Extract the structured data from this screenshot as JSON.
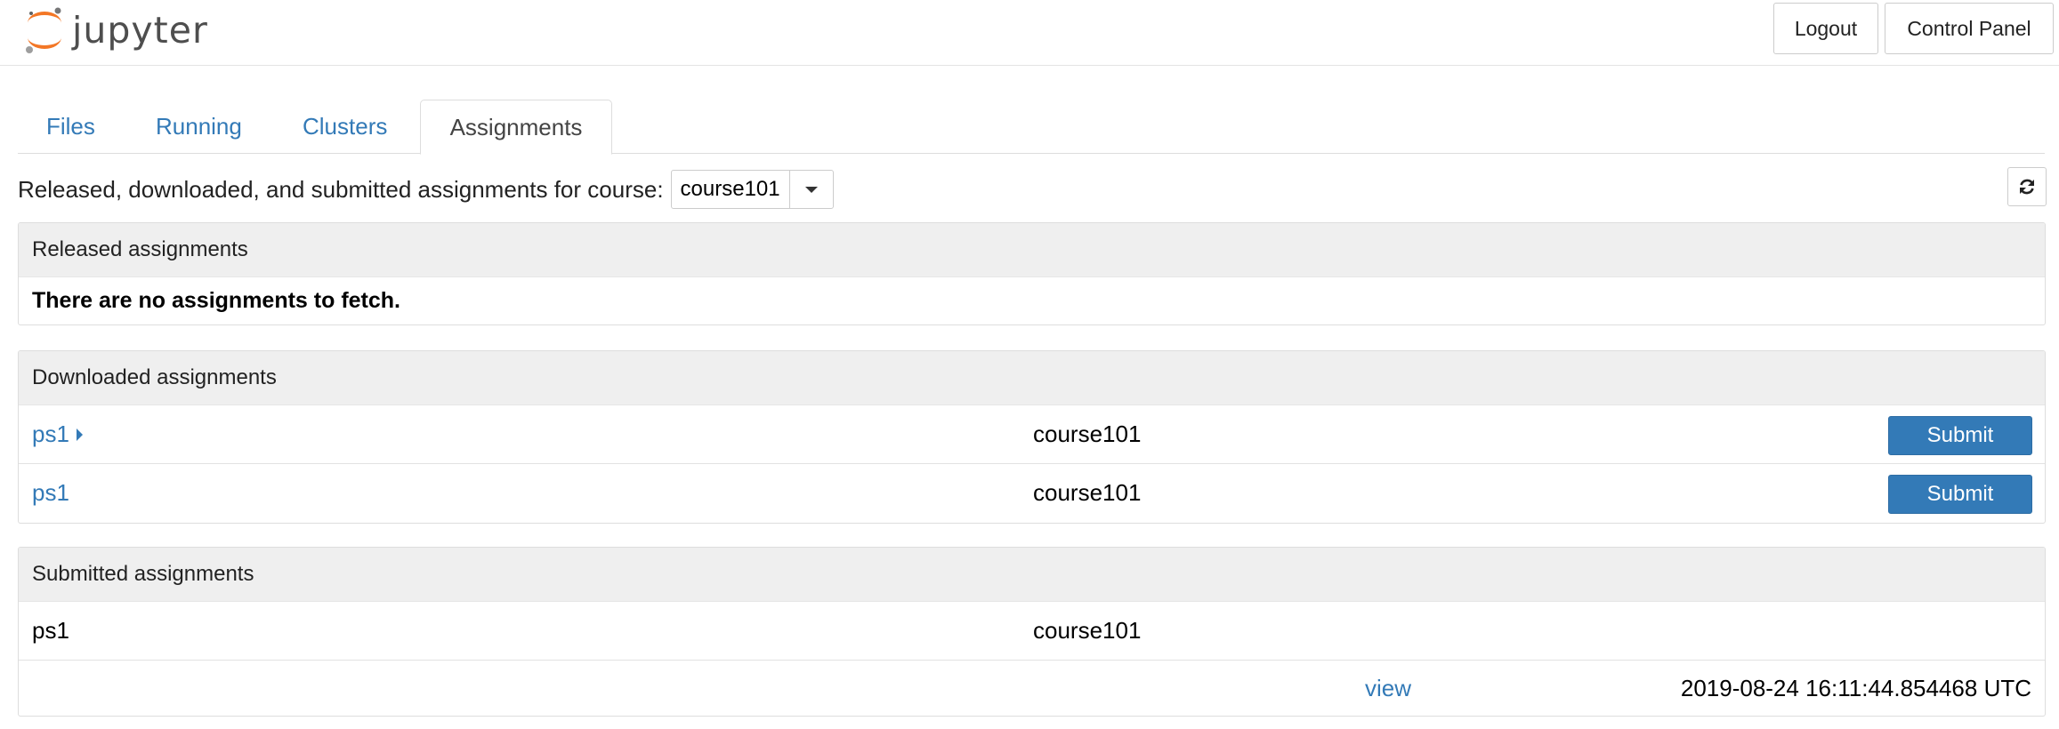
{
  "header": {
    "brand": "jupyter",
    "logout_label": "Logout",
    "control_panel_label": "Control Panel"
  },
  "tabs": [
    {
      "label": "Files"
    },
    {
      "label": "Running"
    },
    {
      "label": "Clusters"
    },
    {
      "label": "Assignments",
      "active": true
    }
  ],
  "course_selector": {
    "label": "Released, downloaded, and submitted assignments for course:",
    "selected": "course101"
  },
  "released": {
    "title": "Released assignments",
    "empty_message": "There are no assignments to fetch."
  },
  "downloaded": {
    "title": "Downloaded assignments",
    "rows": [
      {
        "name": "ps1",
        "course": "course101",
        "action": "Submit",
        "expandable": true
      },
      {
        "name": "ps1",
        "course": "course101",
        "action": "Submit",
        "expandable": false
      }
    ]
  },
  "submitted": {
    "title": "Submitted assignments",
    "rows": [
      {
        "name": "ps1",
        "course": "course101"
      }
    ],
    "detail": {
      "link": "view",
      "timestamp": "2019-08-24 16:11:44.854468 UTC"
    }
  },
  "icons": {
    "logo": "jupyter-logo-icon",
    "refresh": "refresh-icon",
    "dropdown": "chevron-down-icon",
    "expand": "caret-right-icon"
  },
  "colors": {
    "link": "#337ab7",
    "primary_button": "#337ab7",
    "panel_heading": "#efefef",
    "logo_orange": "#f37726"
  }
}
